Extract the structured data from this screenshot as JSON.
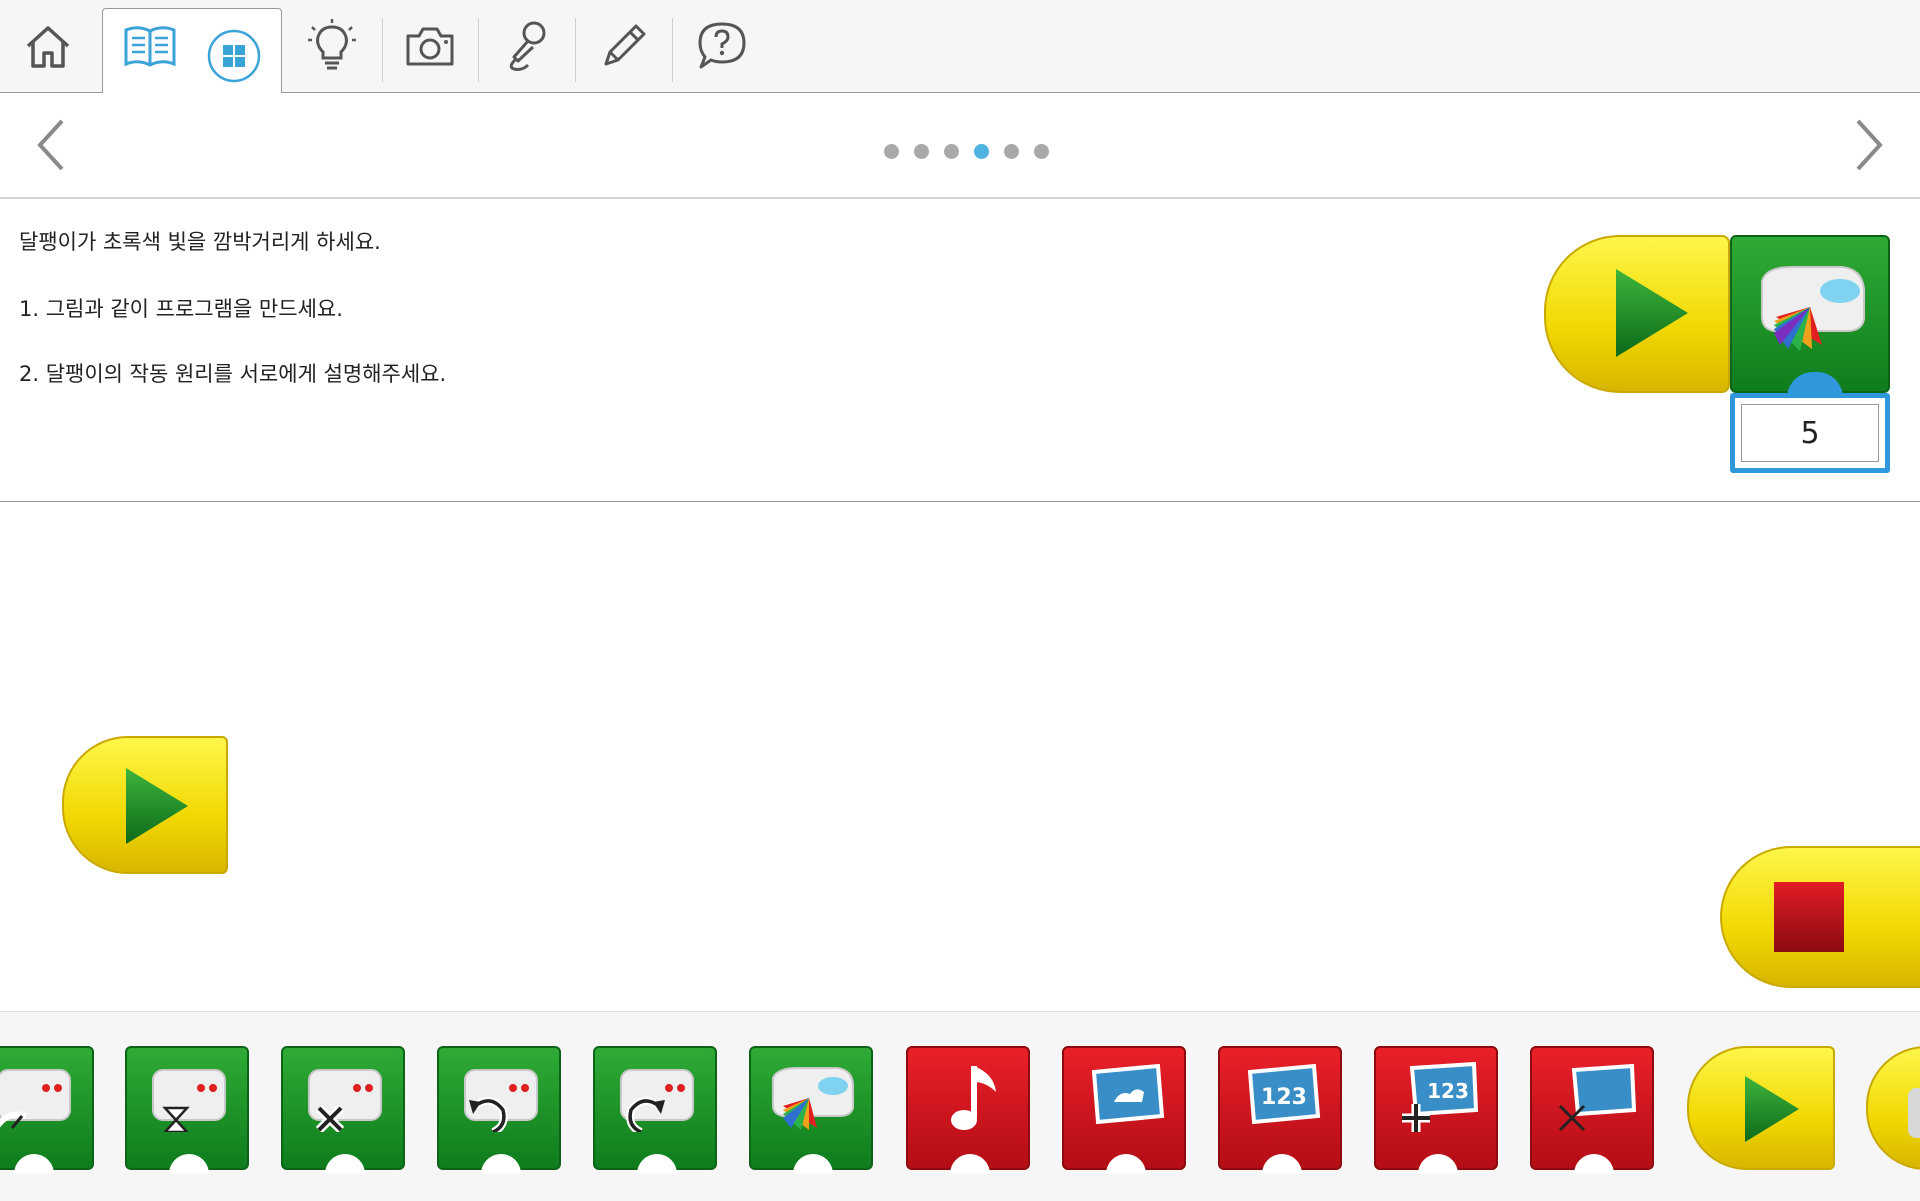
{
  "toolbar": {
    "items": [
      "home-icon",
      "book-icon",
      "grid-icon",
      "lightbulb-icon",
      "camera-icon",
      "microphone-icon",
      "pencil-icon",
      "help-icon"
    ],
    "active_tab": "book-icon",
    "accent": "#3aa3d8"
  },
  "pager": {
    "total_pages": 6,
    "current_page": 4,
    "active_color": "#4fb3e0",
    "inactive_color": "#a9a9a9"
  },
  "instructions": {
    "line1": "달팽이가 초록색 빛을 깜박거리게 하세요.",
    "line2": "1. 그림과 같이 프로그램을 만드세요.",
    "line3": "2. 달팽이의 작동 원리를 서로에게 설명해주세요."
  },
  "example_program": {
    "value": "5"
  },
  "palette": {
    "blocks": [
      "motor-speed-block",
      "motor-time-block",
      "motor-off-block",
      "motor-direction-left-block",
      "motor-direction-right-block",
      "light-block",
      "sound-block",
      "display-background-block",
      "display-number-block",
      "display-add-block",
      "display-shrink-block",
      "start-block"
    ]
  },
  "colors": {
    "green_block": "#1a9127",
    "red_block": "#d8141d",
    "yellow_block": "#f7e31a",
    "blue_input": "#2f97db"
  }
}
